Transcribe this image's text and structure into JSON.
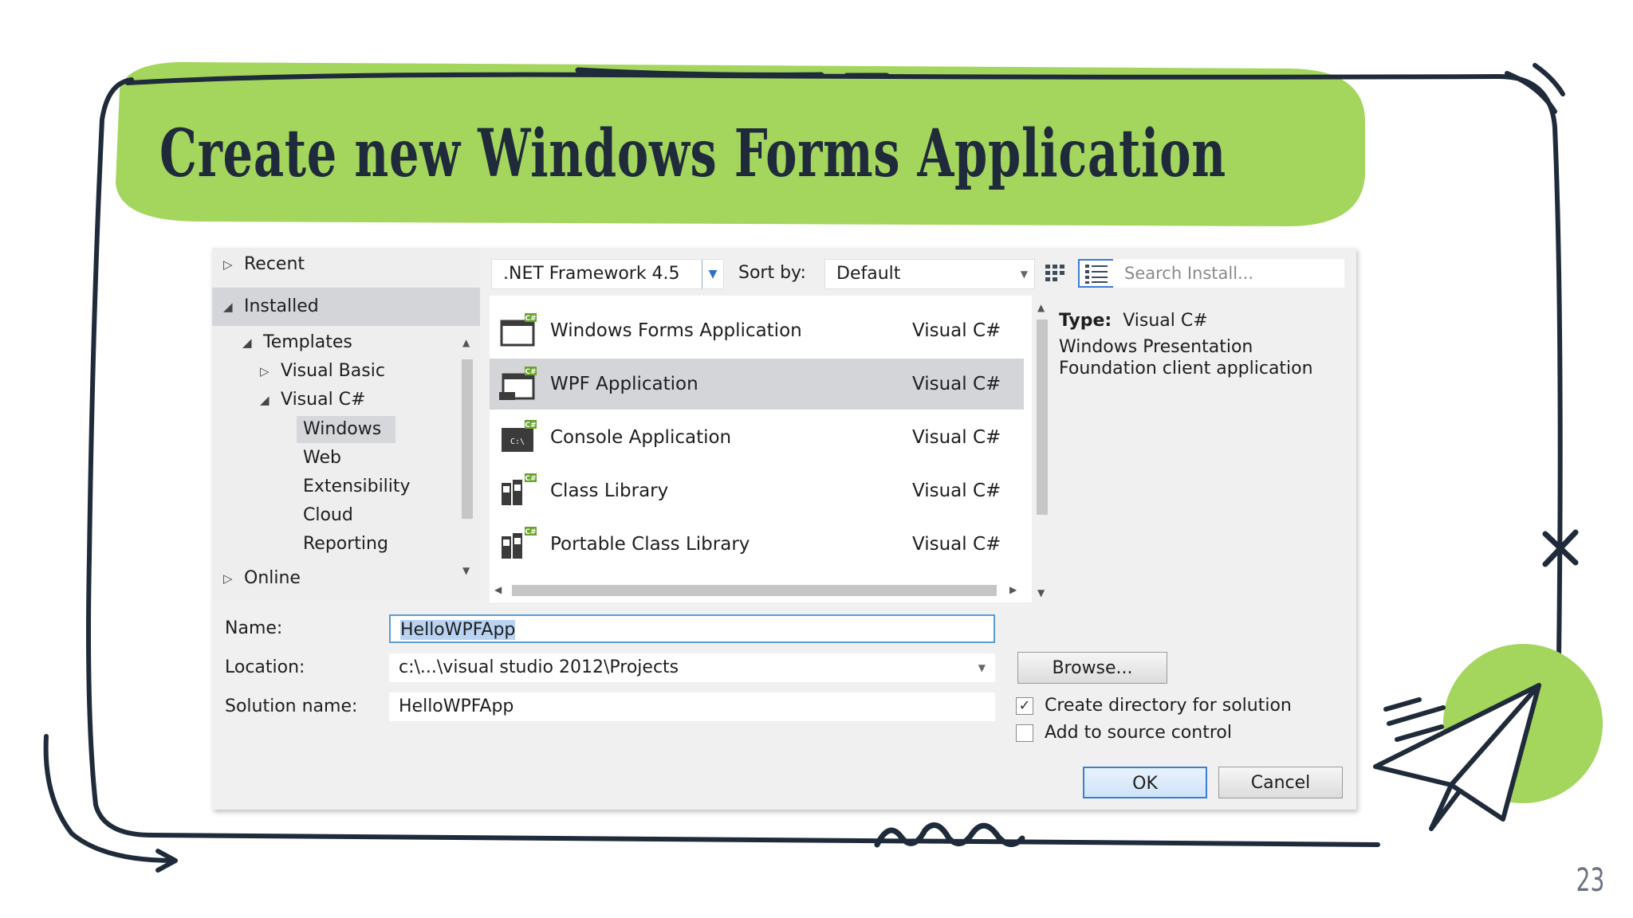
{
  "slide": {
    "title": "Create new Windows Forms Application",
    "page_number": "23"
  },
  "colors": {
    "accent_green": "#a4d65e",
    "ink": "#1f2b3a",
    "selection_blue": "#3c7fd1"
  },
  "dialog": {
    "left_panel": {
      "recent": "Recent",
      "installed": "Installed",
      "templates": "Templates",
      "visual_basic": "Visual Basic",
      "visual_csharp": "Visual C#",
      "windows": "Windows",
      "web": "Web",
      "extensibility": "Extensibility",
      "cloud": "Cloud",
      "reporting": "Reporting",
      "online": "Online"
    },
    "toolbar": {
      "framework": ".NET Framework 4.5",
      "sort_label": "Sort by:",
      "sort_value": "Default",
      "search_placeholder": "Search Install..."
    },
    "templates": [
      {
        "name": "Windows Forms Application",
        "lang": "Visual C#",
        "icon": "winforms-icon"
      },
      {
        "name": "WPF Application",
        "lang": "Visual C#",
        "icon": "wpf-icon"
      },
      {
        "name": "Console Application",
        "lang": "Visual C#",
        "icon": "console-icon"
      },
      {
        "name": "Class Library",
        "lang": "Visual C#",
        "icon": "class-library-icon"
      },
      {
        "name": "Portable Class Library",
        "lang": "Visual C#",
        "icon": "portable-library-icon"
      }
    ],
    "description": {
      "type_label": "Type:",
      "type_value": "Visual C#",
      "text": "Windows Presentation Foundation client application"
    },
    "form": {
      "name_label": "Name:",
      "name_value": "HelloWPFApp",
      "location_label": "Location:",
      "location_value": "c:\\...\\visual studio 2012\\Projects",
      "solution_label": "Solution name:",
      "solution_value": "HelloWPFApp",
      "browse": "Browse...",
      "create_dir": "Create directory for solution",
      "create_dir_checked": true,
      "source_control": "Add to source control",
      "source_control_checked": false,
      "ok": "OK",
      "cancel": "Cancel"
    }
  }
}
